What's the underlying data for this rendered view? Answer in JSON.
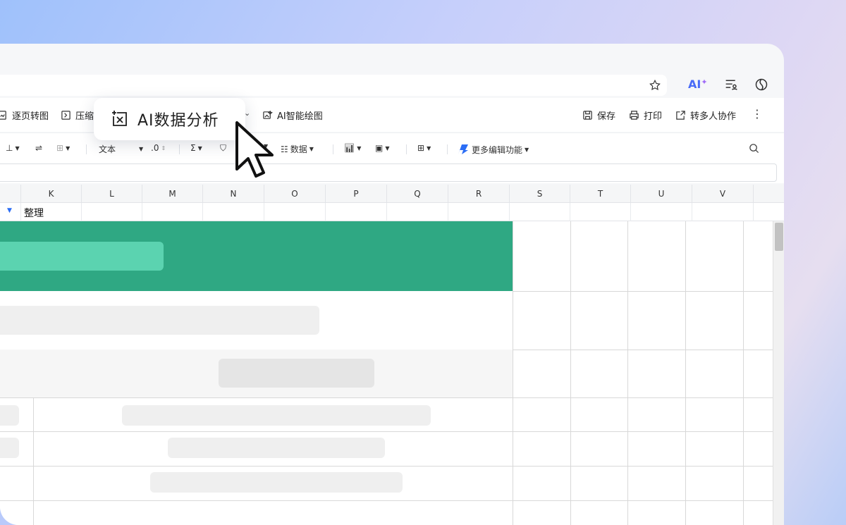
{
  "menu": {
    "page_to_image": "逐页转图",
    "compress": "压缩",
    "ai_draw": "AI智能绘图",
    "save": "保存",
    "print": "打印",
    "share": "转多人协作"
  },
  "toolbar": {
    "text_format": "文本",
    "decimal": ".0",
    "data": "数据",
    "more_edit": "更多编辑功能"
  },
  "columns": [
    "K",
    "L",
    "M",
    "N",
    "O",
    "P",
    "Q",
    "R",
    "S",
    "T",
    "U",
    "V"
  ],
  "name_row": {
    "cell_k": "整理"
  },
  "popup": {
    "label": "AI数据分析"
  },
  "ai_badge": {
    "label": "AI"
  },
  "colors": {
    "green_band": "#2fa883",
    "green_pill": "#5bd3b0",
    "accent": "#4a6cf7"
  }
}
